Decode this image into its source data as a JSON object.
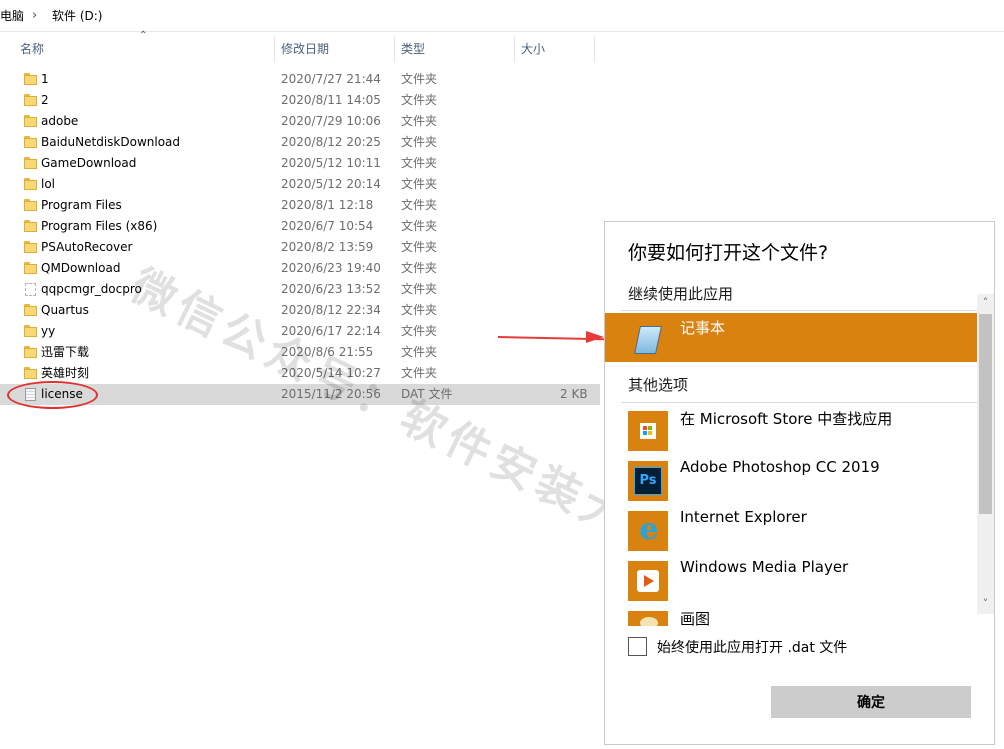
{
  "breadcrumb": {
    "items": [
      "电脑",
      "软件 (D:)"
    ],
    "separator": "›"
  },
  "columns": [
    "名称",
    "修改日期",
    "类型",
    "大小"
  ],
  "files": [
    {
      "name": "1",
      "date": "2020/7/27 21:44",
      "type": "文件夹",
      "size": "",
      "icon": "folder"
    },
    {
      "name": "2",
      "date": "2020/8/11 14:05",
      "type": "文件夹",
      "size": "",
      "icon": "folder"
    },
    {
      "name": "adobe",
      "date": "2020/7/29 10:06",
      "type": "文件夹",
      "size": "",
      "icon": "folder"
    },
    {
      "name": "BaiduNetdiskDownload",
      "date": "2020/8/12 20:25",
      "type": "文件夹",
      "size": "",
      "icon": "folder"
    },
    {
      "name": "GameDownload",
      "date": "2020/5/12 10:11",
      "type": "文件夹",
      "size": "",
      "icon": "folder"
    },
    {
      "name": "lol",
      "date": "2020/5/12 20:14",
      "type": "文件夹",
      "size": "",
      "icon": "folder"
    },
    {
      "name": "Program Files",
      "date": "2020/8/1 12:18",
      "type": "文件夹",
      "size": "",
      "icon": "folder"
    },
    {
      "name": "Program Files (x86)",
      "date": "2020/6/7 10:54",
      "type": "文件夹",
      "size": "",
      "icon": "folder"
    },
    {
      "name": "PSAutoRecover",
      "date": "2020/8/2 13:59",
      "type": "文件夹",
      "size": "",
      "icon": "folder"
    },
    {
      "name": "QMDownload",
      "date": "2020/6/23 19:40",
      "type": "文件夹",
      "size": "",
      "icon": "folder"
    },
    {
      "name": "qqpcmgr_docpro",
      "date": "2020/6/23 13:52",
      "type": "文件夹",
      "size": "",
      "icon": "hidden-folder"
    },
    {
      "name": "Quartus",
      "date": "2020/8/12 22:34",
      "type": "文件夹",
      "size": "",
      "icon": "folder"
    },
    {
      "name": "yy",
      "date": "2020/6/17 22:14",
      "type": "文件夹",
      "size": "",
      "icon": "folder"
    },
    {
      "name": "迅雷下载",
      "date": "2020/8/6 21:55",
      "type": "文件夹",
      "size": "",
      "icon": "folder"
    },
    {
      "name": "英雄时刻",
      "date": "2020/5/14 10:27",
      "type": "文件夹",
      "size": "",
      "icon": "folder"
    },
    {
      "name": "license",
      "date": "2015/11/2 20:56",
      "type": "DAT 文件",
      "size": "2 KB",
      "icon": "file",
      "selected": true
    }
  ],
  "watermark": "微信公众号：软件安装大神",
  "dialog": {
    "title": "你要如何打开这个文件?",
    "continue_section": "继续使用此应用",
    "other_section": "其他选项",
    "selected_app": {
      "label": "记事本",
      "icon": "notepad-icon"
    },
    "apps": [
      {
        "label": "在 Microsoft Store 中查找应用",
        "icon": "store-icon"
      },
      {
        "label": "Adobe Photoshop CC 2019",
        "icon": "photoshop-icon",
        "badge": "Ps"
      },
      {
        "label": "Internet Explorer",
        "icon": "internet-explorer-icon",
        "badge": "e"
      },
      {
        "label": "Windows Media Player",
        "icon": "media-player-icon"
      },
      {
        "label": "画图",
        "icon": "paint-icon"
      }
    ],
    "checkbox_label": "始终使用此应用打开 .dat 文件",
    "checkbox_checked": false,
    "ok_button": "确定",
    "scroll_up": "˄",
    "scroll_down": "˅",
    "accent_color": "#d9820f"
  }
}
